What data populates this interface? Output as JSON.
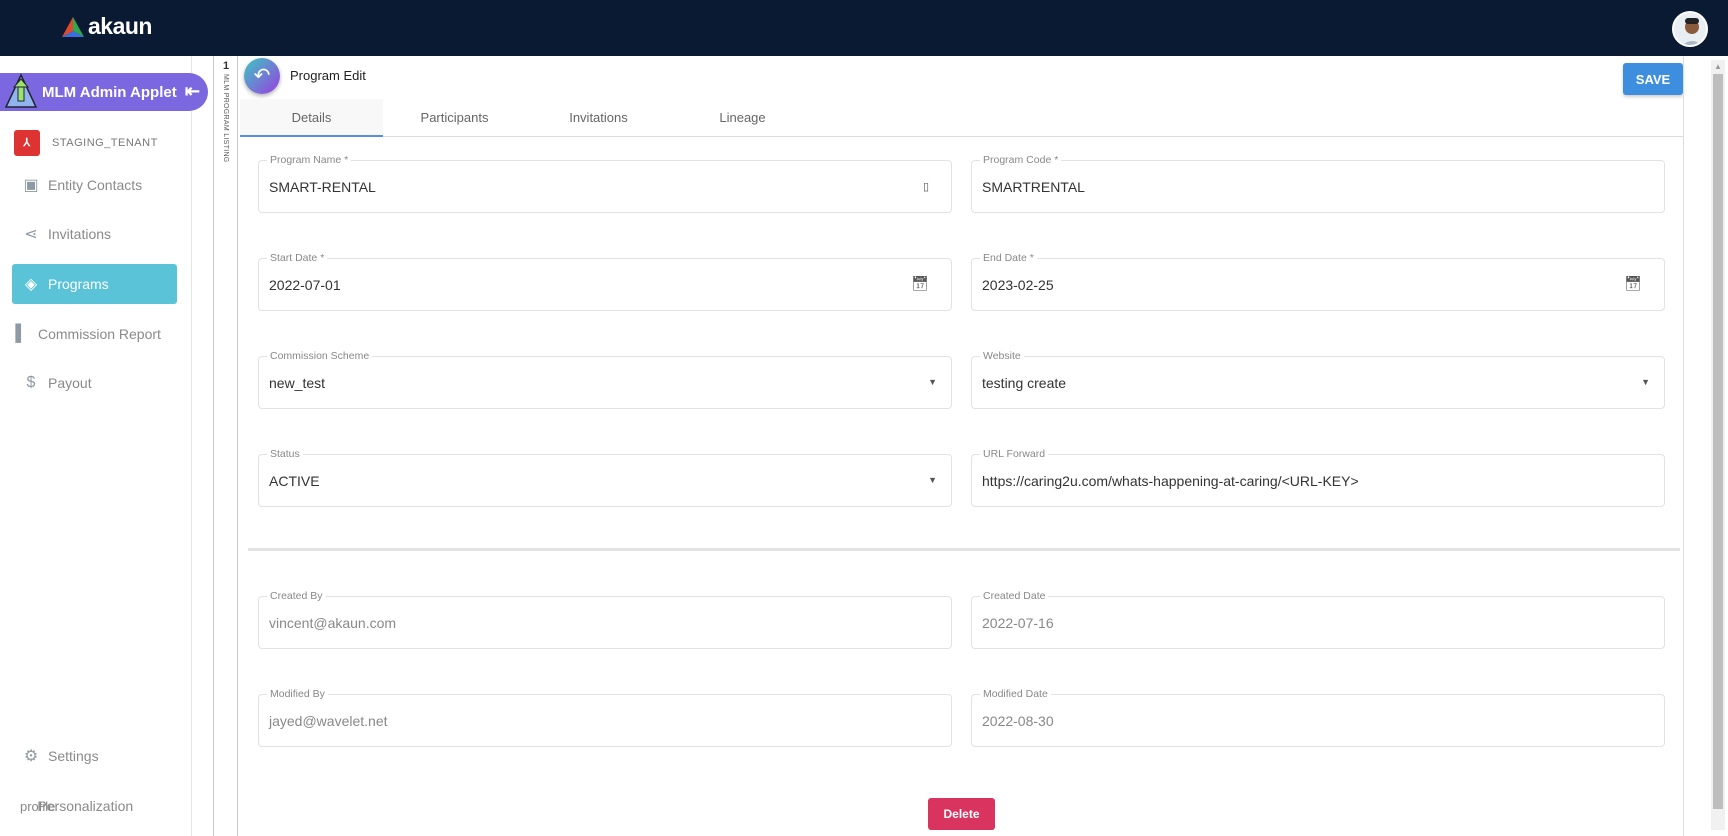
{
  "header": {
    "logo_text": "akaun",
    "avatar": "user-avatar"
  },
  "sidebar": {
    "applet": "MLM Admin Applet",
    "tenant": "STAGING_TENANT",
    "items": [
      {
        "label": "Entity Contacts",
        "icon": "contact-card-icon"
      },
      {
        "label": "Invitations",
        "icon": "share-icon"
      },
      {
        "label": "Programs",
        "icon": "tag-icon",
        "active": true
      },
      {
        "label": "Commission Report",
        "icon": "report-icon"
      },
      {
        "label": "Payout",
        "icon": "dollar-icon"
      }
    ],
    "settings": "Settings",
    "personalization": "Personalization",
    "profile_alt": "profile"
  },
  "strip": {
    "number": "1",
    "label": "MLM PROGRAM LISTING"
  },
  "page": {
    "title": "Program Edit",
    "save": "SAVE",
    "delete": "Delete"
  },
  "tabs": [
    "Details",
    "Participants",
    "Invitations",
    "Lineage"
  ],
  "fields": {
    "program_name": {
      "label": "Program Name *",
      "value": "SMART-RENTAL"
    },
    "program_code": {
      "label": "Program Code *",
      "value": "SMARTRENTAL"
    },
    "start_date": {
      "label": "Start Date *",
      "value": "2022-07-01"
    },
    "end_date": {
      "label": "End Date *",
      "value": "2023-02-25"
    },
    "commission_scheme": {
      "label": "Commission Scheme",
      "value": "new_test"
    },
    "website": {
      "label": "Website",
      "value": "testing create"
    },
    "status": {
      "label": "Status",
      "value": "ACTIVE"
    },
    "url_forward": {
      "label": "URL Forward",
      "value": "https://caring2u.com/whats-happening-at-caring/<URL-KEY>"
    },
    "created_by": {
      "label": "Created By",
      "value": "vincent@akaun.com"
    },
    "created_date": {
      "label": "Created Date",
      "value": "2022-07-16"
    },
    "modified_by": {
      "label": "Modified By",
      "value": "jayed@wavelet.net"
    },
    "modified_date": {
      "label": "Modified Date",
      "value": "2022-08-30"
    }
  }
}
